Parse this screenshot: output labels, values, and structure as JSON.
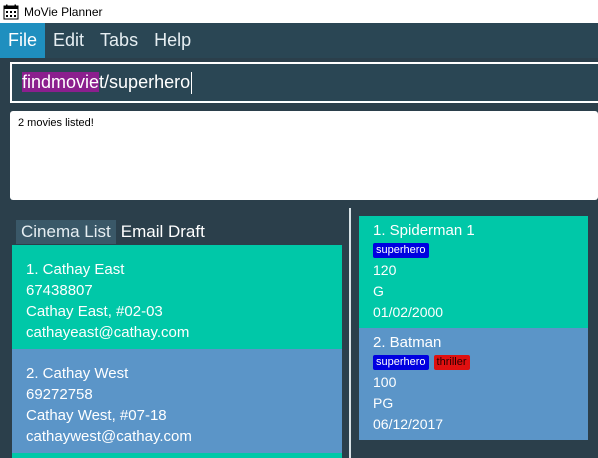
{
  "window": {
    "title": "MoVie Planner"
  },
  "menu": {
    "items": [
      {
        "label": "File"
      },
      {
        "label": "Edit"
      },
      {
        "label": "Tabs"
      },
      {
        "label": "Help"
      }
    ]
  },
  "command": {
    "highlighted": "findmovie",
    "rest": "t/superhero"
  },
  "result": {
    "text": "2 movies listed!"
  },
  "tabs": [
    {
      "label": "Cinema List"
    },
    {
      "label": "Email Draft"
    }
  ],
  "cinemas": [
    {
      "index_name": "1.  Cathay East",
      "phone": "67438807",
      "address": "Cathay East, #02-03",
      "email": "cathayeast@cathay.com"
    },
    {
      "index_name": "2.  Cathay West",
      "phone": "69272758",
      "address": "Cathay West, #07-18",
      "email": "cathaywest@cathay.com"
    }
  ],
  "movies": [
    {
      "index_name": "1.  Spiderman 1",
      "tags": [
        "superhero"
      ],
      "duration": "120",
      "rating": "G",
      "date": "01/02/2000"
    },
    {
      "index_name": "2.  Batman",
      "tags": [
        "superhero",
        "thriller"
      ],
      "duration": "100",
      "rating": "PG",
      "date": "06/12/2017"
    }
  ],
  "colors": {
    "accent": "#1f8fbf",
    "card_green": "#00c8a8",
    "card_blue": "#5b95c8",
    "background": "#2b3f4b",
    "command_highlight": "#8b1f8e",
    "tag_superhero": "#0000e0",
    "tag_thriller": "#e01010"
  }
}
